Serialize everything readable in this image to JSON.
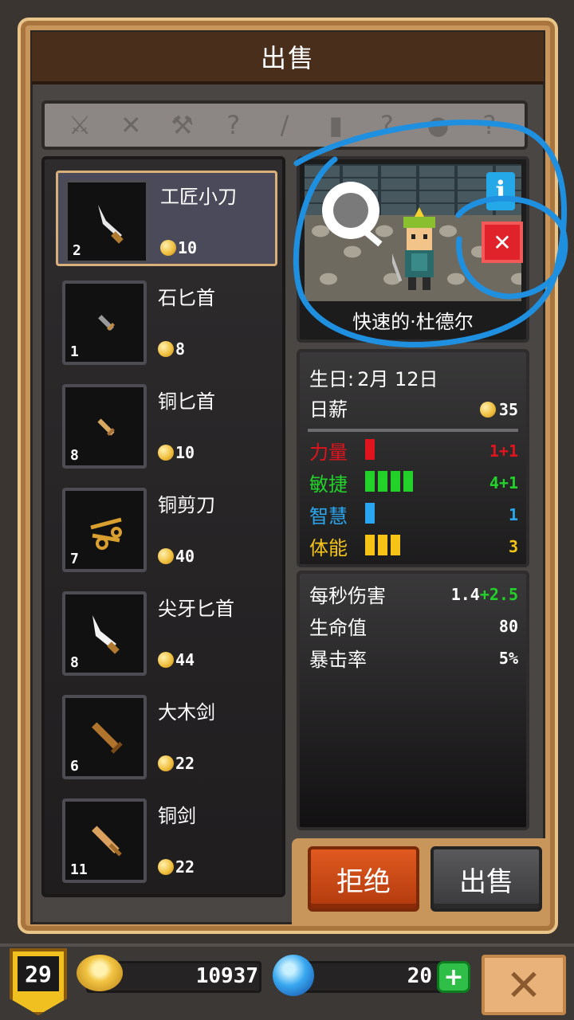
{
  "title": "出售",
  "filter_icons": [
    "dagger-icon",
    "sword-icon",
    "axe-icon",
    "question-icon",
    "staff-icon",
    "bottle-icon",
    "question-icon",
    "pot-icon",
    "question-icon"
  ],
  "items": [
    {
      "name": "工匠小刀",
      "level": "2",
      "price": "10",
      "weapon": "knife-icon"
    },
    {
      "name": "石匕首",
      "level": "1",
      "price": "8",
      "weapon": "dagger-icon"
    },
    {
      "name": "铜匕首",
      "level": "8",
      "price": "10",
      "weapon": "dagger-icon"
    },
    {
      "name": "铜剪刀",
      "level": "7",
      "price": "40",
      "weapon": "scissors-icon"
    },
    {
      "name": "尖牙匕首",
      "level": "8",
      "price": "44",
      "weapon": "fang-icon"
    },
    {
      "name": "大木剑",
      "level": "6",
      "price": "22",
      "weapon": "sword-icon"
    },
    {
      "name": "铜剑",
      "level": "11",
      "price": "22",
      "weapon": "sword-icon"
    }
  ],
  "hero": {
    "name": "快速的·杜德尔",
    "info_label": "i",
    "birthday_label": "生日:",
    "birthday_value": "2月 12日",
    "salary_label": "日薪",
    "salary_value": "35",
    "stats": [
      {
        "name": "力量",
        "value": "1+1",
        "bars": 1,
        "color": "#e0141c"
      },
      {
        "name": "敏捷",
        "value": "4+1",
        "bars": 4,
        "color": "#22d22a"
      },
      {
        "name": "智慧",
        "value": "1",
        "bars": 1,
        "color": "#2aa6f0"
      },
      {
        "name": "体能",
        "value": "3",
        "bars": 3,
        "color": "#f5c416"
      }
    ],
    "combat": [
      {
        "name": "每秒伤害",
        "value": "1.4",
        "bonus": "+2.5"
      },
      {
        "name": "生命值",
        "value": "80",
        "bonus": ""
      },
      {
        "name": "暴击率",
        "value": "5%",
        "bonus": ""
      }
    ]
  },
  "buttons": {
    "reject": "拒绝",
    "sell": "出售"
  },
  "hud": {
    "level": "29",
    "gold": "10937",
    "gems": "20",
    "plus": "+",
    "close": "✕"
  }
}
